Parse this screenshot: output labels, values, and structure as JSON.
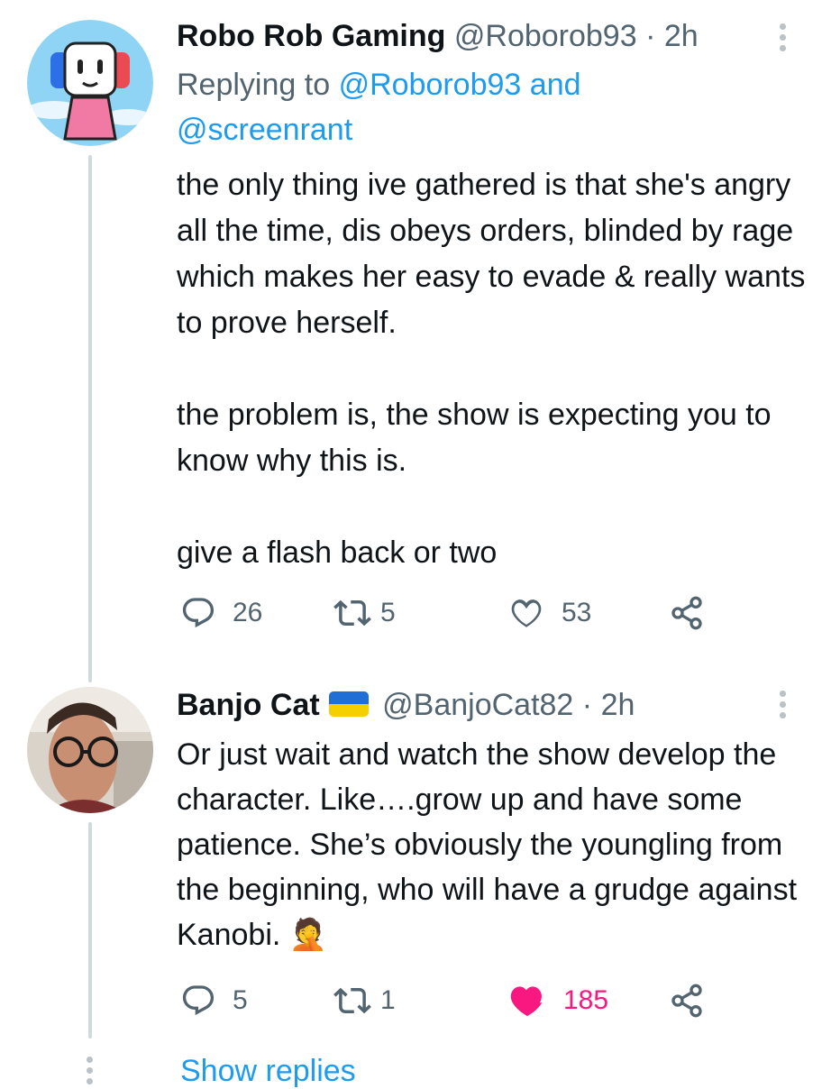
{
  "tweets": [
    {
      "display_name": "Robo Rob Gaming",
      "handle": "@Roborob93",
      "separator": "·",
      "time": "2h",
      "replying_prefix": "Replying to",
      "replying_handle_1": "@Roborob93",
      "replying_and": "and",
      "replying_handle_2": "@screenrant",
      "text": "the only thing ive gathered is that she's angry all the time, dis obeys orders, blinded by rage which makes her easy to evade & really wants to prove herself.\n\nthe problem is, the show is expecting you to know why this is.\n\ngive a flash back or two",
      "replies": "26",
      "retweets": "5",
      "likes": "53",
      "liked": false
    },
    {
      "display_name": "Banjo Cat",
      "handle": "@BanjoCat82",
      "separator": "·",
      "time": "2h",
      "flag_colors": [
        "#1f6fd6",
        "#f5d000"
      ],
      "text": "Or just wait and watch the show develop the character. Like….grow up and have some patience.  She’s obviously the youngling from the beginning, who will have a grudge against Kanobi. 🤦",
      "replies": "5",
      "retweets": "1",
      "likes": "185",
      "liked": true
    }
  ],
  "show_replies_label": "Show replies",
  "colors": {
    "link": "#1d9bf0",
    "muted": "#536471",
    "like_active": "#f91880",
    "thread_line": "#cfd9de"
  },
  "icons": [
    "reply-icon",
    "retweet-icon",
    "like-icon",
    "share-icon",
    "more-icon"
  ]
}
